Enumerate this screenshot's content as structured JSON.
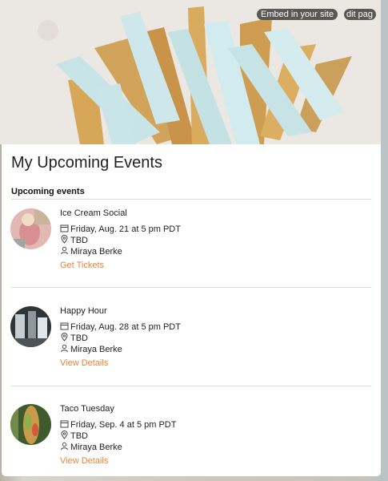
{
  "hero": {
    "embed_label": "Embed in your site",
    "edit_label": "dit pag"
  },
  "page": {
    "title": "My Upcoming Events",
    "section_heading": "Upcoming events"
  },
  "events": [
    {
      "name": "Ice Cream Social",
      "date": "Friday, Aug. 21 at 5 pm PDT",
      "location": "TBD",
      "host": "Miraya Berke",
      "action": "Get Tickets"
    },
    {
      "name": "Happy Hour",
      "date": "Friday, Aug. 28 at 5 pm PDT",
      "location": "TBD",
      "host": "Miraya Berke",
      "action": "View Details"
    },
    {
      "name": "Taco Tuesday",
      "date": "Friday, Sep. 4 at 5 pm PDT",
      "location": "TBD",
      "host": "Miraya Berke",
      "action": "View Details"
    }
  ],
  "colors": {
    "accent": "#e8833a",
    "pill_bg": "#5a5754"
  }
}
